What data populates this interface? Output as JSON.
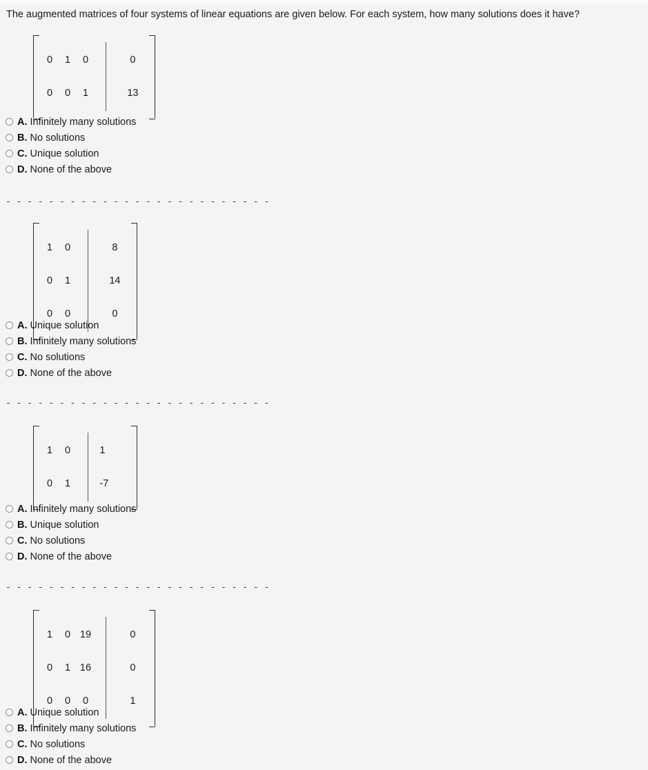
{
  "prompt": "The augmented matrices of four systems of linear equations are given below. For each system, how many solutions does it have?",
  "separator": "- - - - - - - - - - - - - - - - - - - - - - - - -",
  "colors": {
    "page_background": "#f4f4f4",
    "text": "#1a1a1a",
    "bracket": "#2b2b2b",
    "divider": "#565656",
    "radio_border": "#8e8e8e"
  },
  "systems": [
    {
      "id": "system-1",
      "matrix": {
        "rows": 2,
        "coefficient_columns": 3,
        "coefficients": [
          [
            "0",
            "1",
            "0"
          ],
          [
            "0",
            "0",
            "1"
          ]
        ],
        "augmented": [
          "0",
          "13"
        ],
        "augmented_align": "center"
      },
      "options": [
        {
          "letter": "A.",
          "text": "Infinitely many solutions",
          "selected": false
        },
        {
          "letter": "B.",
          "text": "No solutions",
          "selected": false
        },
        {
          "letter": "C.",
          "text": "Unique solution",
          "selected": false
        },
        {
          "letter": "D.",
          "text": "None of the above",
          "selected": false
        }
      ]
    },
    {
      "id": "system-2",
      "matrix": {
        "rows": 3,
        "coefficient_columns": 2,
        "coefficients": [
          [
            "1",
            "0"
          ],
          [
            "0",
            "1"
          ],
          [
            "0",
            "0"
          ]
        ],
        "augmented": [
          "8",
          "14",
          "0"
        ],
        "augmented_align": "center"
      },
      "options": [
        {
          "letter": "A.",
          "text": "Unique solution",
          "selected": false
        },
        {
          "letter": "B.",
          "text": "Infinitely many solutions",
          "selected": false
        },
        {
          "letter": "C.",
          "text": "No solutions",
          "selected": false
        },
        {
          "letter": "D.",
          "text": "None of the above",
          "selected": false
        }
      ]
    },
    {
      "id": "system-3",
      "matrix": {
        "rows": 2,
        "coefficient_columns": 2,
        "coefficients": [
          [
            "1",
            "0"
          ],
          [
            "0",
            "1"
          ]
        ],
        "augmented": [
          "1",
          "-7"
        ],
        "augmented_align": "left"
      },
      "options": [
        {
          "letter": "A.",
          "text": "Infinitely many solutions",
          "selected": false
        },
        {
          "letter": "B.",
          "text": "Unique solution",
          "selected": false
        },
        {
          "letter": "C.",
          "text": "No solutions",
          "selected": false
        },
        {
          "letter": "D.",
          "text": "None of the above",
          "selected": false
        }
      ]
    },
    {
      "id": "system-4",
      "matrix": {
        "rows": 3,
        "coefficient_columns": 3,
        "coefficients": [
          [
            "1",
            "0",
            "19"
          ],
          [
            "0",
            "1",
            "16"
          ],
          [
            "0",
            "0",
            "0"
          ]
        ],
        "augmented": [
          "0",
          "0",
          "1"
        ],
        "augmented_align": "center"
      },
      "options": [
        {
          "letter": "A.",
          "text": "Unique solution",
          "selected": false
        },
        {
          "letter": "B.",
          "text": "Infinitely many solutions",
          "selected": false
        },
        {
          "letter": "C.",
          "text": "No solutions",
          "selected": false
        },
        {
          "letter": "D.",
          "text": "None of the above",
          "selected": false
        }
      ]
    }
  ]
}
